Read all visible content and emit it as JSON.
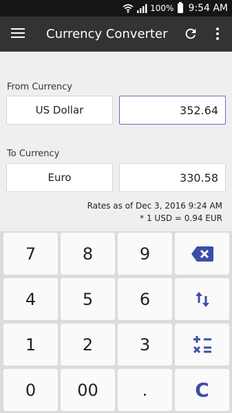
{
  "status": {
    "battery_pct": "100%",
    "time": "9:54 AM"
  },
  "appbar": {
    "title": "Currency Converter"
  },
  "from": {
    "label": "From Currency",
    "currency": "US Dollar",
    "amount": "352.64"
  },
  "to": {
    "label": "To Currency",
    "currency": "Euro",
    "amount": "330.58"
  },
  "rates": {
    "line1": "Rates as of Dec 3, 2016 9:24 AM",
    "line2": "* 1 USD = 0.94 EUR"
  },
  "keys": {
    "k7": "7",
    "k8": "8",
    "k9": "9",
    "k4": "4",
    "k5": "5",
    "k6": "6",
    "k1": "1",
    "k2": "2",
    "k3": "3",
    "k0": "0",
    "k00": "00",
    "kdot": ".",
    "clear": "C"
  },
  "icons": {
    "backspace": "backspace-icon",
    "swap": "swap-icon",
    "calculator": "calculator-icon"
  },
  "colors": {
    "appbar": "#333333",
    "accent": "#3c4fa6",
    "active_border": "#5a6fb8"
  }
}
